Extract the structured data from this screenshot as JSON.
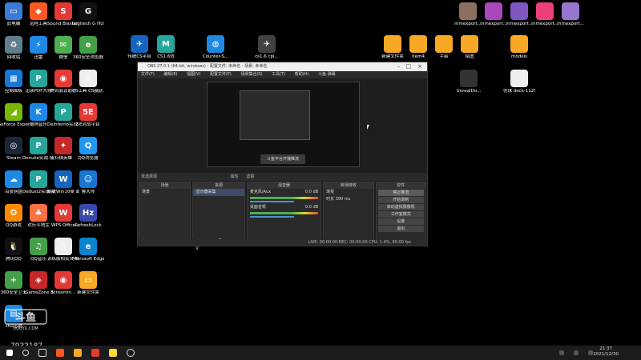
{
  "desktop": {
    "icons_left": [
      {
        "label": "此电脑",
        "color": "#3a7bd5",
        "glyph": "▭"
      },
      {
        "label": "远程工具",
        "color": "#ff5722",
        "glyph": "◆"
      },
      {
        "label": "Sound Blaster ...",
        "color": "#e53935",
        "glyph": "S"
      },
      {
        "label": "Logitech G HUB",
        "color": "#111111",
        "glyph": "G"
      },
      {
        "label": "回收站",
        "color": "#607d8b",
        "glyph": "♻"
      },
      {
        "label": "迅雷",
        "color": "#1e88e5",
        "glyph": "⚡"
      },
      {
        "label": "微信",
        "color": "#4caf50",
        "glyph": "✉"
      },
      {
        "label": "360安全浏览器",
        "color": "#43a047",
        "glyph": "e"
      },
      {
        "label": "控制面板",
        "color": "#1976d2",
        "glyph": "▦"
      },
      {
        "label": "迅读PDF大师",
        "color": "#26a69a",
        "glyph": "P"
      },
      {
        "label": "腾讯会议助手",
        "color": "#e53935",
        "glyph": "◉"
      },
      {
        "label": "CS工具 CS捕获...",
        "color": "#eeeeee",
        "glyph": "▯"
      },
      {
        "label": "GeForce Experience",
        "color": "#76b900",
        "glyph": "◢"
      },
      {
        "label": "酷狗音乐",
        "color": "#1e88e5",
        "glyph": "K"
      },
      {
        "label": "Deinferno实战 战捕获大全",
        "color": "#26a69a",
        "glyph": "P"
      },
      {
        "label": "5E对战平台",
        "color": "#e53935",
        "glyph": "5E"
      },
      {
        "label": "Steam",
        "color": "#1b2838",
        "glyph": "◎"
      },
      {
        "label": "Denuke实战 捕获大全",
        "color": "#26a69a",
        "glyph": "P"
      },
      {
        "label": "扫描英雄",
        "color": "#c62828",
        "glyph": "✦"
      },
      {
        "label": "QQ浏览器",
        "color": "#2196f3",
        "glyph": "Q"
      },
      {
        "label": "百度网盘",
        "color": "#1e88e5",
        "glyph": "☁"
      },
      {
        "label": "Dedust2实战 捕获大全",
        "color": "#26a69a",
        "glyph": "P"
      },
      {
        "label": "解决Win10桌 面下CS自动...",
        "color": "#1565c0",
        "glyph": "W"
      },
      {
        "label": "鲁大师",
        "color": "#1976d2",
        "glyph": "☺"
      },
      {
        "label": "QQ游戏",
        "color": "#fb8c00",
        "glyph": "✪"
      },
      {
        "label": "欢乐斗地主",
        "color": "#ff7043",
        "glyph": "♣"
      },
      {
        "label": "WPS Office",
        "color": "#e53935",
        "glyph": "W"
      },
      {
        "label": "RefreshLock",
        "color": "#3949ab",
        "glyph": "Hz"
      },
      {
        "label": "腾讯QQ",
        "color": "#111111",
        "glyph": "🐧"
      },
      {
        "label": "QQ音乐",
        "color": "#43a047",
        "glyph": "♫"
      },
      {
        "label": "训练服相关文 档",
        "color": "#eeeeee",
        "glyph": "▯"
      },
      {
        "label": "Microsoft Edge",
        "color": "#0a84d0",
        "glyph": "e"
      },
      {
        "label": "360安全卫士",
        "color": "#43a047",
        "glyph": "+"
      },
      {
        "label": "iGameZone II",
        "color": "#c62828",
        "glyph": "◈"
      },
      {
        "label": "Streamin...",
        "color": "#e53935",
        "glyph": "◉"
      },
      {
        "label": "新建文件夹",
        "color": "#f9a825",
        "glyph": "▭"
      },
      {
        "label": "360压缩",
        "color": "#1e88e5",
        "glyph": "▤"
      }
    ],
    "icons_mid": [
      {
        "label": "传统CS平台",
        "color": "#1565c0",
        "glyph": "✈"
      },
      {
        "label": "CS1.6仿",
        "color": "#26a69a",
        "glyph": "M"
      },
      {
        "label": "Counter-S...",
        "color": "#1e88e5",
        "glyph": "◍"
      },
      {
        "label": "cs1.6 cpl...",
        "color": "#424242",
        "glyph": "✈"
      }
    ],
    "icons_right_top": [
      {
        "label": "mmexport...",
        "color": "#8d6e63"
      },
      {
        "label": "mmexport...",
        "color": "#ab47bc"
      },
      {
        "label": "mmexport...",
        "color": "#7e57c2"
      },
      {
        "label": "mmexport...",
        "color": "#ec407a"
      },
      {
        "label": "mmexport...",
        "color": "#9575cd"
      }
    ],
    "icons_right_row2": [
      {
        "label": "新建文件夹",
        "color": "#f9a825"
      },
      {
        "label": "item4",
        "color": "#f9a825"
      },
      {
        "label": "手串",
        "color": "#f9a825"
      },
      {
        "label": "绘图",
        "color": "#f9a825"
      },
      {
        "label": "models",
        "color": "#f9a825"
      }
    ],
    "icons_right_row3": [
      {
        "label": "UnrealDo...",
        "color": "#333333"
      },
      {
        "label": "仿球 deck-1125",
        "color": "#eeeeee"
      }
    ]
  },
  "obs": {
    "title": "OBS 27.0.1 (64-bit, windows) - 配置文件: 未命名 - 场景: 未命名",
    "menu": [
      "文件(F)",
      "编辑(E)",
      "视图(V)",
      "配置文件(P)",
      "场景集合(S)",
      "工具(T)",
      "帮助(H)",
      "斗鱼-弹幕"
    ],
    "preview_button": "斗鱼平台开播推流",
    "source_bar": {
      "selected": "未选择源",
      "props": "属性",
      "filters": "滤镜"
    },
    "docks": {
      "scenes": {
        "title": "场景",
        "items": [
          "场景"
        ]
      },
      "sources": {
        "title": "来源",
        "items": [
          "显示器采集"
        ]
      },
      "mixer": {
        "title": "混音器",
        "tracks": [
          {
            "name": "麦克风/Aux",
            "level": "0.0 dB"
          },
          {
            "name": "桌面音频",
            "level": "0.0 dB"
          }
        ]
      },
      "transitions": {
        "title": "转场特效",
        "type": "渐变",
        "duration_label": "时长",
        "duration": "300 ms"
      },
      "controls": {
        "title": "控件",
        "buttons": [
          "停止推流",
          "开始录制",
          "启动虚拟摄像机",
          "工作室模式",
          "设置",
          "退出"
        ]
      }
    },
    "status": "LIVE: 00:00:00   REC: 00:00:00   CPU: 1.4%, 60.00 fps"
  },
  "watermark": {
    "brand": "斗鱼",
    "sub": "DOUYU.COM",
    "room_id": "7932187"
  },
  "clock": {
    "time": "21:37",
    "date": "2021/12/30"
  }
}
